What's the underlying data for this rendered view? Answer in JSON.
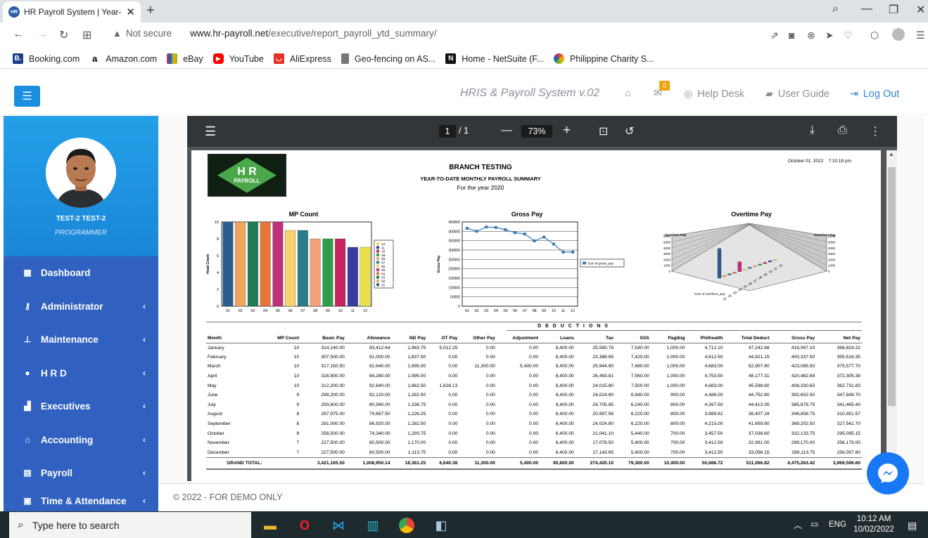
{
  "browser": {
    "tab_title": "HR Payroll System | Year-To",
    "security": "Not secure",
    "url_domain": "www.hr-payroll.net",
    "url_path": "/executive/report_payroll_ytd_summary/",
    "bookmarks": [
      "Booking.com",
      "Amazon.com",
      "eBay",
      "YouTube",
      "AliExpress",
      "Geo-fencing on AS...",
      "Home - NetSuite (F...",
      "Philippine Charity S..."
    ]
  },
  "header": {
    "system_name": "HRIS & Payroll System v.02",
    "mail_badge": "0",
    "help_desk": "Help Desk",
    "user_guide": "User Guide",
    "logout": "Log Out"
  },
  "sidebar": {
    "user_name": "TEST-2 TEST-2",
    "user_role": "PROGRAMMER",
    "items": [
      {
        "label": "Dashboard",
        "icon": "dashboard-icon"
      },
      {
        "label": "Administrator",
        "icon": "key-icon"
      },
      {
        "label": "Maintenance",
        "icon": "sitemap-icon"
      },
      {
        "label": "H R D",
        "icon": "user-icon"
      },
      {
        "label": "Executives",
        "icon": "chart-icon"
      },
      {
        "label": "Accounting",
        "icon": "bank-icon"
      },
      {
        "label": "Payroll",
        "icon": "calculator-icon"
      },
      {
        "label": "Time & Attendance",
        "icon": "calendar-icon"
      }
    ]
  },
  "pdf": {
    "page_current": "1",
    "page_total": "/ 1",
    "zoom": "73%"
  },
  "report": {
    "logo_line1": "H R",
    "logo_line2": "PAYROLL",
    "company": "BRANCH TESTING",
    "title": "YEAR-TO-DATE MONTHLY PAYROLL SUMMARY",
    "subtitle": "For the year 2020",
    "timestamp": "October 01, 2022    7:10:19 pm",
    "deductions_header": "D E D U C T I O N S",
    "columns": [
      "Month",
      "MP Count",
      "Basic Pay",
      "Allowance",
      "ND Pay",
      "OT Pay",
      "Other Pay",
      "Adjustment",
      "Loans",
      "Tax",
      "SSS",
      "Pagibig",
      "Philhealth",
      "Total Deduct",
      "Gross Pay",
      "Net Pay"
    ],
    "rows": [
      [
        "January",
        "10",
        "314,140.00",
        "93,412.64",
        "1,963.75",
        "5,012.25",
        "0.00",
        "0.00",
        "8,400.00",
        "25,590.78",
        "7,540.00",
        "1,000.00",
        "4,712.10",
        "47,242.88",
        "416,067.10",
        "368,824.22"
      ],
      [
        "February",
        "10",
        "307,500.00",
        "91,000.00",
        "1,837.50",
        "0.00",
        "0.00",
        "0.00",
        "8,400.00",
        "23,388.65",
        "7,420.00",
        "1,000.00",
        "4,612.50",
        "44,821.15",
        "400,337.50",
        "355,516.35"
      ],
      [
        "March",
        "10",
        "317,150.50",
        "92,640.00",
        "1,995.00",
        "0.00",
        "11,300.00",
        "5,400.00",
        "8,400.00",
        "25,944.80",
        "7,480.00",
        "1,000.00",
        "4,683.00",
        "52,907.80",
        "423,085.50",
        "375,577.70"
      ],
      [
        "April",
        "10",
        "316,900.00",
        "94,280.00",
        "1,995.00",
        "0.00",
        "0.00",
        "0.00",
        "8,400.00",
        "26,463.81",
        "7,560.00",
        "1,000.00",
        "4,753.50",
        "48,177.31",
        "420,482.69",
        "372,305.38"
      ],
      [
        "May",
        "10",
        "312,200.00",
        "92,640.00",
        "1,862.50",
        "1,628.13",
        "0.00",
        "0.00",
        "8,400.00",
        "24,015.80",
        "7,500.00",
        "1,000.00",
        "4,683.00",
        "45,598.80",
        "408,330.63",
        "362,731.83"
      ],
      [
        "June",
        "9",
        "299,200.00",
        "92,120.00",
        "1,282.50",
        "0.00",
        "0.00",
        "0.00",
        "8,400.00",
        "24,024.80",
        "6,940.00",
        "900.00",
        "4,488.00",
        "44,752.80",
        "392,602.50",
        "347,849.70"
      ],
      [
        "July",
        "9",
        "293,600.00",
        "90,940.00",
        "1,338.75",
        "0.00",
        "0.00",
        "0.00",
        "8,400.00",
        "24,705.85",
        "6,240.00",
        "800.00",
        "4,267.50",
        "44,413.35",
        "385,878.75",
        "341,465.40"
      ],
      [
        "August",
        "8",
        "267,975.00",
        "79,657.50",
        "1,226.25",
        "0.00",
        "0.00",
        "0.00",
        "6,400.00",
        "20,997.56",
        "6,220.00",
        "800.00",
        "3,989.62",
        "38,407.18",
        "348,858.75",
        "310,451.57"
      ],
      [
        "September",
        "8",
        "281,000.00",
        "86,920.00",
        "1,282.50",
        "0.00",
        "0.00",
        "0.00",
        "6,400.00",
        "24,024.80",
        "6,220.00",
        "800.00",
        "4,215.00",
        "41,659.80",
        "369,202.50",
        "327,542.70"
      ],
      [
        "October",
        "8",
        "256,500.00",
        "74,340.00",
        "1,293.75",
        "0.00",
        "0.00",
        "0.00",
        "6,400.00",
        "21,041.10",
        "5,440.00",
        "700.00",
        "3,457.50",
        "37,038.60",
        "332,133.75",
        "295,095.15"
      ],
      [
        "November",
        "7",
        "227,500.00",
        "60,500.00",
        "1,170.00",
        "0.00",
        "0.00",
        "0.00",
        "6,400.00",
        "17,078.50",
        "5,400.00",
        "700.00",
        "3,412.50",
        "32,991.00",
        "289,170.00",
        "256,179.00"
      ],
      [
        "December",
        "7",
        "227,500.00",
        "60,500.00",
        "1,113.75",
        "0.00",
        "0.00",
        "0.00",
        "6,400.00",
        "17,143.65",
        "5,400.00",
        "700.00",
        "3,412.50",
        "33,056.15",
        "289,113.75",
        "256,057.60"
      ]
    ],
    "totals": [
      "GRAND TOTAL:",
      "",
      "3,421,165.50",
      "1,008,950.14",
      "18,361.25",
      "6,640.38",
      "11,300.00",
      "5,400.00",
      "90,800.00",
      "274,420.10",
      "79,360.00",
      "10,400.00",
      "50,686.72",
      "511,066.82",
      "4,475,263.42",
      "3,969,596.60"
    ]
  },
  "chart_data": [
    {
      "type": "bar",
      "title": "MP Count",
      "ylabel": "Head Count",
      "categories": [
        "01",
        "02",
        "03",
        "04",
        "05",
        "06",
        "07",
        "08",
        "09",
        "10",
        "11",
        "12"
      ],
      "values": [
        10,
        10,
        10,
        10,
        10,
        9,
        9,
        8,
        8,
        8,
        7,
        7
      ],
      "colors": [
        "#2e5c8f",
        "#f2a45c",
        "#1f7a56",
        "#e8743b",
        "#c0307a",
        "#f7d36b",
        "#2a7d8a",
        "#f4a27a",
        "#2f9e4a",
        "#c7245e",
        "#3a3ea0",
        "#e9e04a"
      ],
      "ylim": [
        0,
        10
      ],
      "yticks": [
        "0",
        "2",
        "4",
        "6",
        "8",
        "10"
      ],
      "legend": [
        "12",
        "11",
        "10",
        "09",
        "08",
        "07",
        "06",
        "05",
        "04",
        "03",
        "02",
        "01"
      ],
      "legend_position": "right"
    },
    {
      "type": "line",
      "title": "Gross Pay",
      "ylabel": "Gross Pay",
      "categories": [
        "01",
        "02",
        "03",
        "04",
        "05",
        "06",
        "07",
        "08",
        "09",
        "10",
        "11",
        "12"
      ],
      "values": [
        416067.1,
        400337.5,
        423085.5,
        420482.69,
        408330.63,
        392602.5,
        385878.75,
        348858.75,
        369202.5,
        332133.75,
        289170.0,
        289113.75
      ],
      "ylim": [
        0,
        450000
      ],
      "yticks": [
        "0",
        "50000",
        "100000",
        "150000",
        "200000",
        "250000",
        "300000",
        "350000",
        "400000",
        "450000"
      ],
      "legend": [
        "Sum of gross_pay"
      ],
      "legend_position": "right"
    },
    {
      "type": "bar",
      "title": "Overtime Pay",
      "ylabel": "Overtime Pay",
      "categories": [
        "01",
        "02",
        "03",
        "04",
        "05",
        "06",
        "07",
        "08",
        "09",
        "10",
        "11",
        "12"
      ],
      "values": [
        5012.25,
        0,
        0,
        0,
        1628.13,
        0,
        0,
        0,
        0,
        0,
        0,
        0
      ],
      "yticks": [
        "0",
        "1000",
        "2000",
        "3000",
        "4000",
        "5000",
        "6000"
      ],
      "series_label": "Sum of overtime_pay"
    }
  ],
  "taskbar": {
    "search_placeholder": "Type here to search",
    "lang": "ENG",
    "time": "10:12 AM",
    "date": "10/02/2022"
  },
  "footer": {
    "copyright": "© 2022 - FOR DEMO ONLY"
  }
}
